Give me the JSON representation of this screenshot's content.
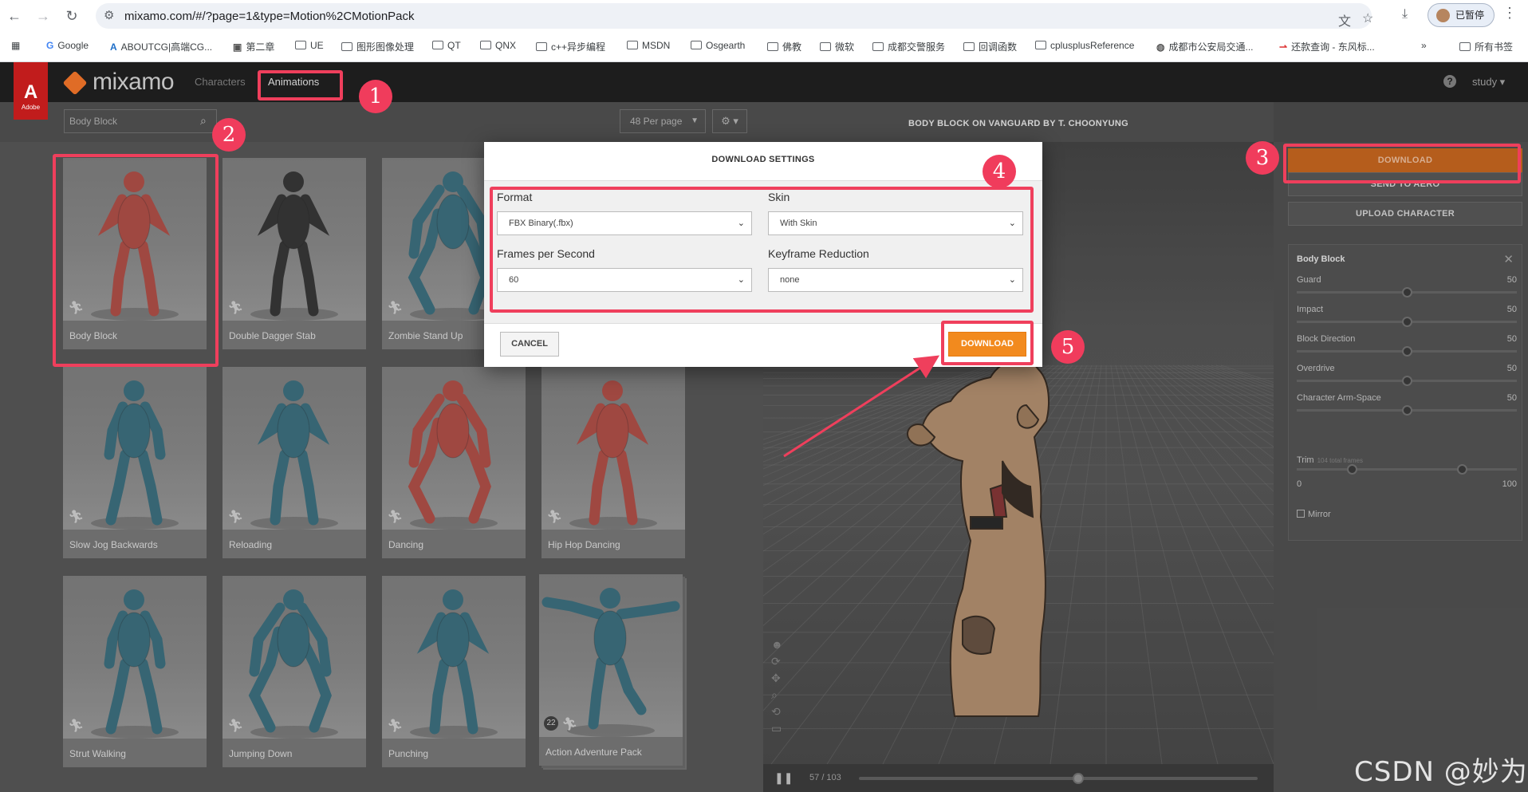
{
  "browser": {
    "url": "mixamo.com/#/?page=1&type=Motion%2CMotionPack",
    "profile_label": "已暂停",
    "bookmarks": [
      "Google",
      "ABOUTCG|高端CG...",
      "第二章",
      "UE",
      "图形图像处理",
      "QT",
      "QNX",
      "c++异步编程",
      "MSDN",
      "Osgearth",
      "佛教",
      "微软",
      "成都交警服务",
      "回调函数",
      "cplusplusReference",
      "成都市公安局交通...",
      "还款查询 - 东风标..."
    ],
    "all_bookmarks": "所有书签",
    "more_bookmarks": "»"
  },
  "app": {
    "logo_text": "mixamo",
    "adobe_text": "Adobe",
    "nav": {
      "characters": "Characters",
      "animations": "Animations"
    },
    "user": "study ▾",
    "help": "?"
  },
  "toolbar": {
    "search_value": "Body Block",
    "per_page": "48 Per page",
    "settings": "⚙ ▾"
  },
  "animations": [
    {
      "label": "Body Block",
      "color": "#b5524b",
      "pose": "guard"
    },
    {
      "label": "Double Dagger Stab",
      "color": "#3a3a3a",
      "pose": "guard"
    },
    {
      "label": "Zombie Stand Up",
      "color": "#3f7383",
      "pose": "crouch"
    },
    {
      "label": "Slow Jog Backwards",
      "color": "#3f7383",
      "pose": "walk"
    },
    {
      "label": "Reloading",
      "color": "#3f7383",
      "pose": "guard"
    },
    {
      "label": "Dancing",
      "color": "#b5524b",
      "pose": "crouch"
    },
    {
      "label": "Hip Hop Dancing",
      "color": "#b5524b",
      "pose": "guard"
    },
    {
      "label": "Strut Walking",
      "color": "#3f7383",
      "pose": "walk"
    },
    {
      "label": "Jumping Down",
      "color": "#3f7383",
      "pose": "crouch"
    },
    {
      "label": "Punching",
      "color": "#3f7383",
      "pose": "guard"
    },
    {
      "label": "Action Adventure Pack",
      "color": "#3f7383",
      "pose": "tpose",
      "pack_count": "22"
    }
  ],
  "viewer": {
    "title": "BODY BLOCK ON VANGUARD BY T. CHOONYUNG",
    "frame": "57",
    "frame_total": "/ 103",
    "progress": 0.55,
    "play_icon": "pause-icon"
  },
  "side_panel": {
    "download": "DOWNLOAD",
    "send_to_aero": "SEND TO AERO",
    "upload_character": "UPLOAD CHARACTER",
    "params_title": "Body Block",
    "params": [
      {
        "name": "Guard",
        "value": "50",
        "level": 0.5
      },
      {
        "name": "Impact",
        "value": "50",
        "level": 0.5
      },
      {
        "name": "Block Direction",
        "value": "50",
        "level": 0.5
      },
      {
        "name": "Overdrive",
        "value": "50",
        "level": 0.5
      },
      {
        "name": "Character Arm-Space",
        "value": "50",
        "level": 0.5
      }
    ],
    "trim_label": "Trim",
    "trim_sub": "104 total frames",
    "trim_min": "0",
    "trim_max": "100",
    "trim_start": 0.25,
    "trim_end": 0.75,
    "mirror_label": "Mirror"
  },
  "modal": {
    "title": "DOWNLOAD SETTINGS",
    "format_label": "Format",
    "format_value": "FBX Binary(.fbx)",
    "skin_label": "Skin",
    "skin_value": "With Skin",
    "fps_label": "Frames per Second",
    "fps_value": "60",
    "keyframe_label": "Keyframe Reduction",
    "keyframe_value": "none",
    "cancel": "CANCEL",
    "download": "DOWNLOAD"
  },
  "annotations": {
    "steps": [
      "1",
      "2",
      "3",
      "4",
      "5"
    ],
    "color": "#ef3f5c"
  },
  "watermark": "CSDN @妙为"
}
